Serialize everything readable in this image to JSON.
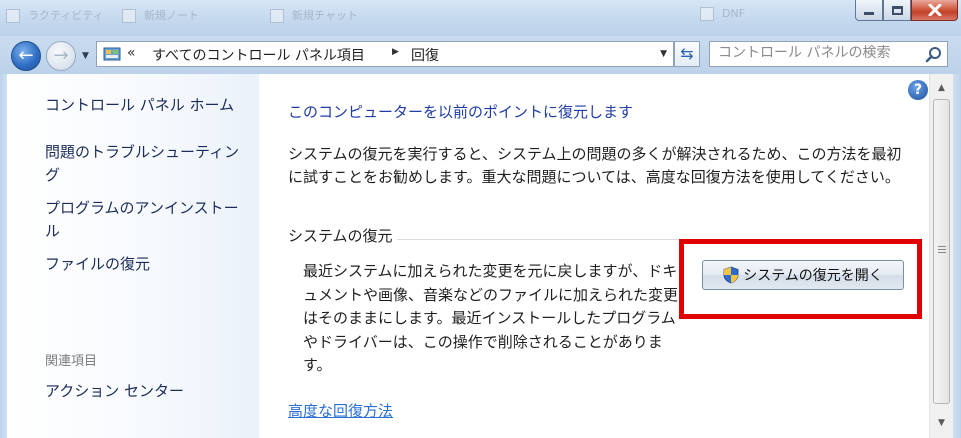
{
  "titlebar": {
    "ghost_items": [
      "ラクティビティ",
      "新規ノート",
      "新規チャット",
      "DNF"
    ]
  },
  "address_bar": {
    "overflow": "«",
    "crumb_root": "すべてのコントロール パネル項目",
    "crumb_current": "回復",
    "separator_icon": "chevron-right-icon"
  },
  "search": {
    "placeholder": "コントロール パネルの検索"
  },
  "sidebar": {
    "home": "コントロール パネル ホーム",
    "links": [
      "問題のトラブルシューティング",
      "プログラムのアンインストール",
      "ファイルの復元"
    ],
    "related_heading": "関連項目",
    "related_links": [
      "アクション センター"
    ]
  },
  "main": {
    "title": "このコンピューターを以前のポイントに復元します",
    "description": "システムの復元を実行すると、システム上の問題の多くが解決されるため、この方法を最初に試すことをお勧めします。重大な問題については、高度な回復方法を使用してください。",
    "section_title": "システムの復元",
    "section_description": "最近システムに加えられた変更を元に戻しますが、ドキュメントや画像、音楽などのファイルに加えられた変更はそのままにします。最近インストールしたプログラムやドライバーは、この操作で削除されることがあります。",
    "restore_button": "システムの復元を開く",
    "advanced_link": "高度な回復方法"
  },
  "colors": {
    "link": "#1f3ca8",
    "highlight": "#e00000",
    "titlebar": "#c4d8ee"
  }
}
